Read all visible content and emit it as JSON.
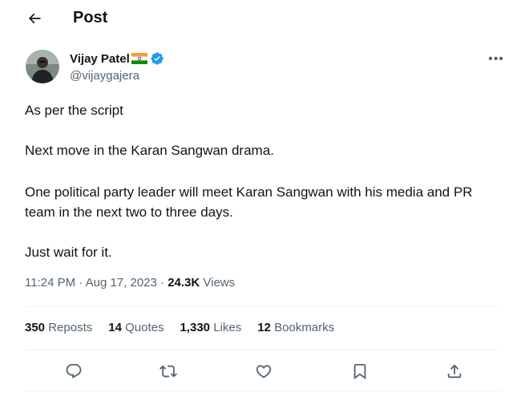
{
  "header": {
    "title": "Post",
    "back_icon": "arrow-left-icon"
  },
  "author": {
    "name": "Vijay Patel",
    "handle": "@vijaygajera",
    "verified": true,
    "flag_icon": "india-flag-icon",
    "verified_icon": "verified-badge-icon"
  },
  "tweet": {
    "lines": [
      "As per the script",
      "Next move in the Karan Sangwan drama.",
      "One political party leader will meet Karan Sangwan with his media and PR team in the next two to three days.",
      "Just wait for it."
    ]
  },
  "meta": {
    "time": "11:24 PM",
    "separator": " · ",
    "date": "Aug 17, 2023",
    "views_count": "24.3K",
    "views_label": " Views"
  },
  "stats": {
    "reposts": {
      "count": "350",
      "label": "Reposts"
    },
    "quotes": {
      "count": "14",
      "label": "Quotes"
    },
    "likes": {
      "count": "1,330",
      "label": "Likes"
    },
    "bookmarks": {
      "count": "12",
      "label": "Bookmarks"
    }
  },
  "actions": {
    "reply_icon": "reply-icon",
    "repost_icon": "repost-icon",
    "like_icon": "heart-icon",
    "bookmark_icon": "bookmark-icon",
    "share_icon": "share-icon"
  },
  "colors": {
    "text_primary": "#0f1419",
    "text_secondary": "#536471",
    "verified_blue": "#1d9bf0",
    "divider": "#eff3f4"
  }
}
